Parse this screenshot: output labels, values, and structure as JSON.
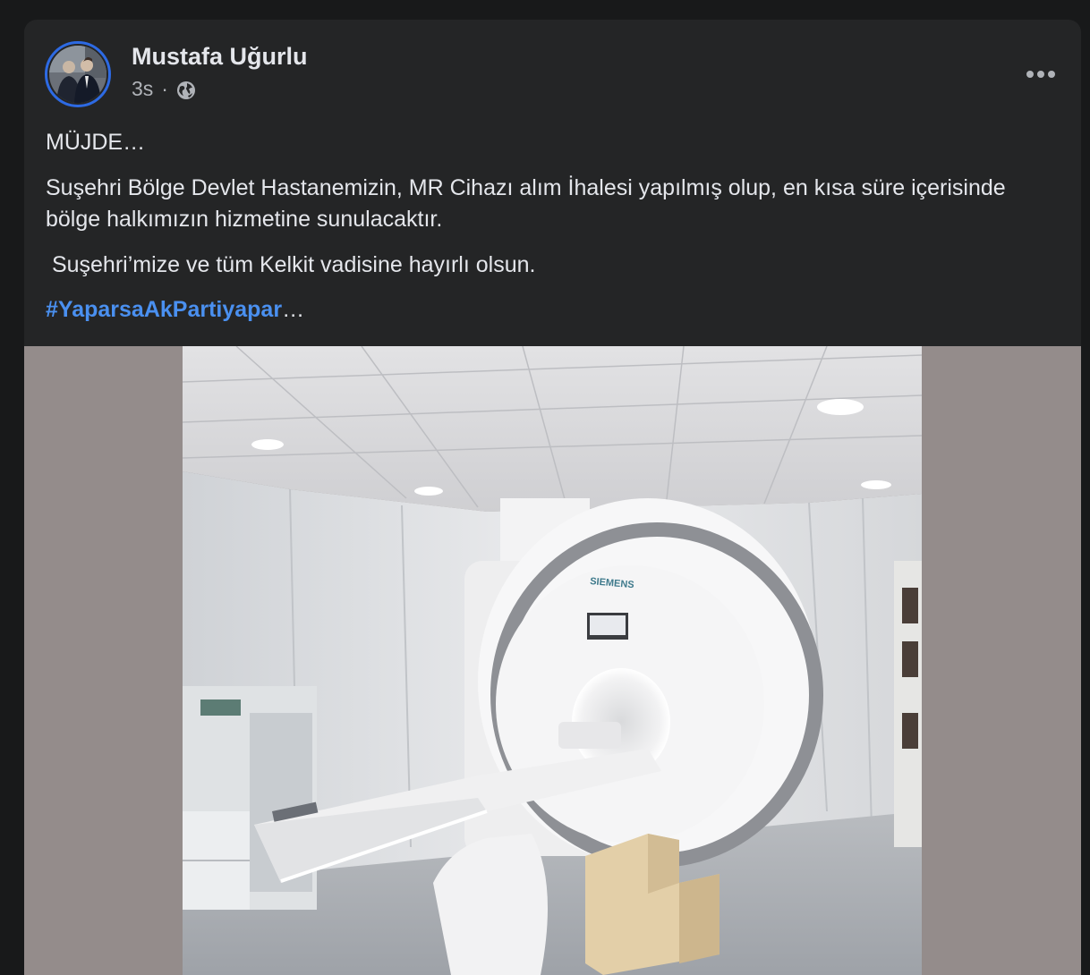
{
  "post": {
    "author": "Mustafa Uğurlu",
    "timestamp": "3s",
    "separator": "·",
    "privacy_icon": "globe-icon",
    "more_icon": "more-horizontal-icon",
    "avatar_icon": "profile-photo",
    "text": {
      "headline": "MÜJDE…",
      "body": "Suşehri Bölge Devlet Hastanemizin, MR Cihazı alım İhalesi yapılmış olup, en kısa süre içerisinde bölge halkımızın hizmetine sunulacaktır.",
      "wish": " Suşehri’mize ve tüm Kelkit vadisine hayırlı olsun.",
      "hashtag": "#YaparsaAkPartiyapar",
      "truncation": "…"
    },
    "photo_brand": "SIEMENS"
  },
  "colors": {
    "background": "#18191a",
    "card": "#242526",
    "text_primary": "#e4e6eb",
    "text_secondary": "#b0b3b8",
    "link": "#4a90f0",
    "avatar_ring": "#2d6ae3",
    "media_bg": "#948c8b"
  }
}
